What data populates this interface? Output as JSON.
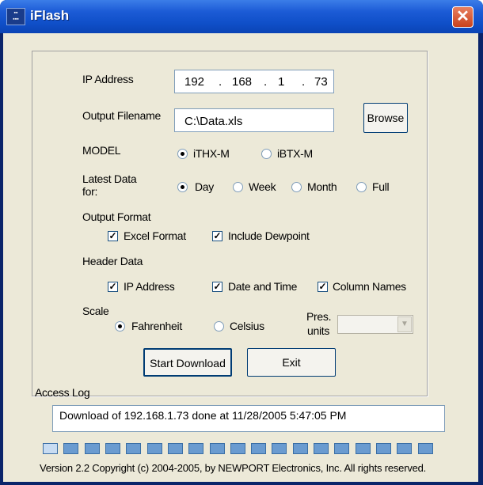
{
  "window": {
    "title": "iFlash",
    "icon_text": "iFlash",
    "close_glyph": "✕",
    "accent": "#0f4fc8",
    "close_color": "#c9411c"
  },
  "form": {
    "ip_label": "IP Address",
    "ip_octets": [
      "192",
      "168",
      "1",
      "73"
    ],
    "ip_sep": ".",
    "output_label": "Output Filename",
    "output_value": "C:\\Data.xls",
    "browse_label": "Browse",
    "model_label": "MODEL",
    "model_options": [
      {
        "label": "iTHX-M",
        "checked": true
      },
      {
        "label": "iBTX-M",
        "checked": false
      }
    ],
    "latest_label_1": "Latest Data",
    "latest_label_2": "for:",
    "latest_options": [
      {
        "label": "Day",
        "checked": true
      },
      {
        "label": "Week",
        "checked": false
      },
      {
        "label": "Month",
        "checked": false
      },
      {
        "label": "Full",
        "checked": false
      }
    ],
    "output_format_label": "Output Format",
    "format_checks": [
      {
        "label": "Excel Format",
        "checked": true
      },
      {
        "label": "Include Dewpoint",
        "checked": true
      }
    ],
    "header_data_label": "Header Data",
    "header_checks": [
      {
        "label": "IP Address",
        "checked": true
      },
      {
        "label": "Date and Time",
        "checked": true
      },
      {
        "label": "Column Names",
        "checked": true
      }
    ],
    "scale_label": "Scale",
    "scale_options": [
      {
        "label": "Fahrenheit",
        "checked": true
      },
      {
        "label": "Celsius",
        "checked": false
      }
    ],
    "pres_label_1": "Pres.",
    "pres_label_2": "units",
    "pres_value": "",
    "start_label": "Start Download",
    "exit_label": "Exit"
  },
  "log": {
    "label": "Access Log",
    "text": "Download of 192.168.1.73 done at 11/28/2005 5:47:05 PM"
  },
  "progress": {
    "segments": 19,
    "lit_segments": 1
  },
  "footer": {
    "version": "Version 2.2 Copyright (c) 2004-2005, by NEWPORT Electronics, Inc.  All rights reserved."
  }
}
